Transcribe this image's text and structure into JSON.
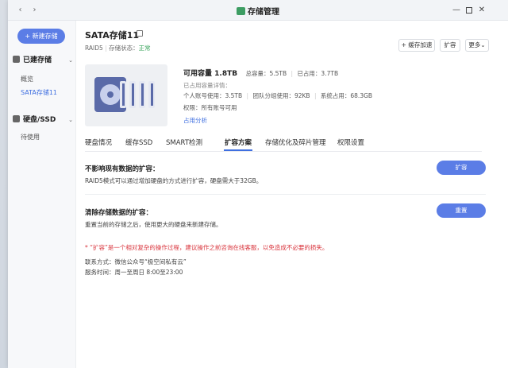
{
  "window": {
    "title": "存储管理",
    "back_icon": "chevron-left-icon",
    "forward_icon": "chevron-right-icon"
  },
  "sidebar": {
    "new_button": "+ 新建存储",
    "groups": [
      {
        "label": "已建存储",
        "items": [
          "概览",
          "SATA存储11"
        ]
      },
      {
        "label": "硬盘/SSD",
        "items": [
          "待使用"
        ]
      }
    ]
  },
  "volume": {
    "name": "SATA存储11",
    "raid": "RAID5",
    "status_label": "存储状态：",
    "status_value": "正常",
    "buttons": {
      "cache": "+ 缓存加速",
      "expand": "扩容",
      "more": "更多"
    }
  },
  "capacity": {
    "available": "可用容量 1.8TB",
    "total": "总容量：5.5TB",
    "used": "已占用：3.7TB",
    "detail_title": "已占用容量详情：",
    "personal": "个人账号使用：3.5TB",
    "team": "团队分组使用：92KB",
    "system": "系统占用：68.3GB",
    "permission": "权限：所有账号可用",
    "analysis_link": "占用分析"
  },
  "tabs": [
    "硬盘情况",
    "缓存SSD",
    "SMART检测",
    "扩容方案",
    "存储优化及碎片管理",
    "权限设置"
  ],
  "active_tab": "扩容方案",
  "plans": {
    "expand_title": "不影响现有数据的扩容：",
    "expand_desc": "RAID5模式可以通过增加硬盘的方式进行扩容，硬盘需大于32GB。",
    "expand_button": "扩容",
    "reset_title": "清除存储数据的扩容：",
    "reset_desc": "重置当前的存储之后，使用更大的硬盘来新建存储。",
    "reset_button": "重置"
  },
  "notice": {
    "warning": "* “扩容”是一个相对复杂的操作过程，建议操作之前咨询在线客服，以免造成不必要的损失。",
    "contact": "联系方式：微信公众号“极空间私有云”",
    "hours": "服务时间：周一至周日 8:00至23:00"
  },
  "colors": {
    "accent": "#5b7de6",
    "status_ok": "#3ba55d",
    "warning": "#d9363e",
    "link": "#3f6fe0"
  }
}
